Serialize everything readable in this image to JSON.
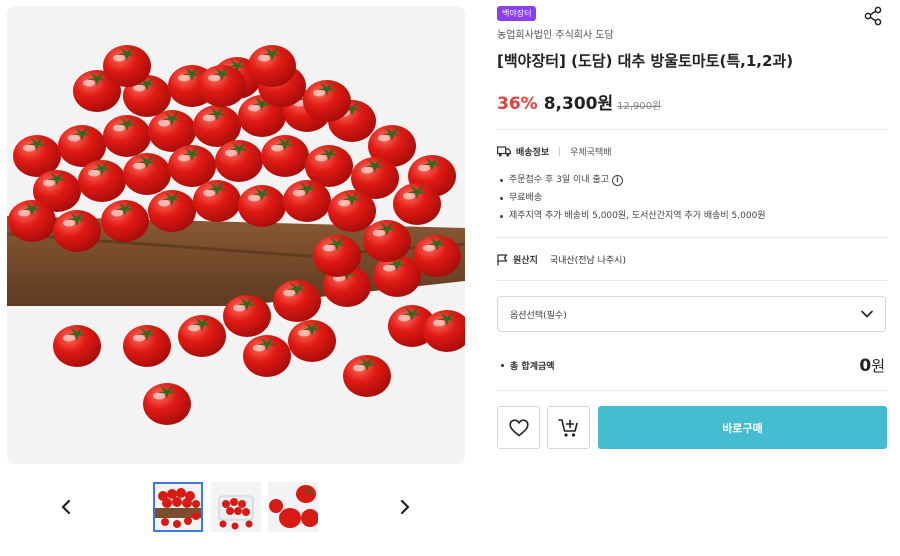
{
  "product": {
    "badge": "백야장터",
    "seller": "농업회사법인 주식회사 도담",
    "title": "[백야장터] (도담) 대추 방울토마토(특,1,2과)",
    "discount": "36%",
    "price": "8,300원",
    "original_price": "12,900원"
  },
  "shipping": {
    "label": "배송정보",
    "carrier": "우체국택배",
    "notes": [
      "주문접수 후 3일 이내 출고",
      "무료배송",
      "제주지역 추가 배송비 5,000원, 도서산간지역 추가 배송비 5,000원"
    ]
  },
  "origin": {
    "label": "원산지",
    "value": "국내산(전남 나주시)"
  },
  "option_select": {
    "placeholder": "옵션선택(필수)"
  },
  "total": {
    "label": "총 합계금액",
    "amount": "0",
    "unit": "원"
  },
  "buttons": {
    "buy": "바로구매"
  },
  "icons": {
    "share": "share-icon",
    "truck": "truck-icon",
    "flag": "flag-icon",
    "info": "info-icon",
    "chevron": "chevron-down-icon",
    "heart": "heart-icon",
    "cart": "cart-plus-icon",
    "prev": "chevron-left-icon",
    "next": "chevron-right-icon"
  },
  "colors": {
    "badge": "#8a3ff2",
    "discount": "#e53e3e",
    "buy_button": "#45bdd0"
  }
}
